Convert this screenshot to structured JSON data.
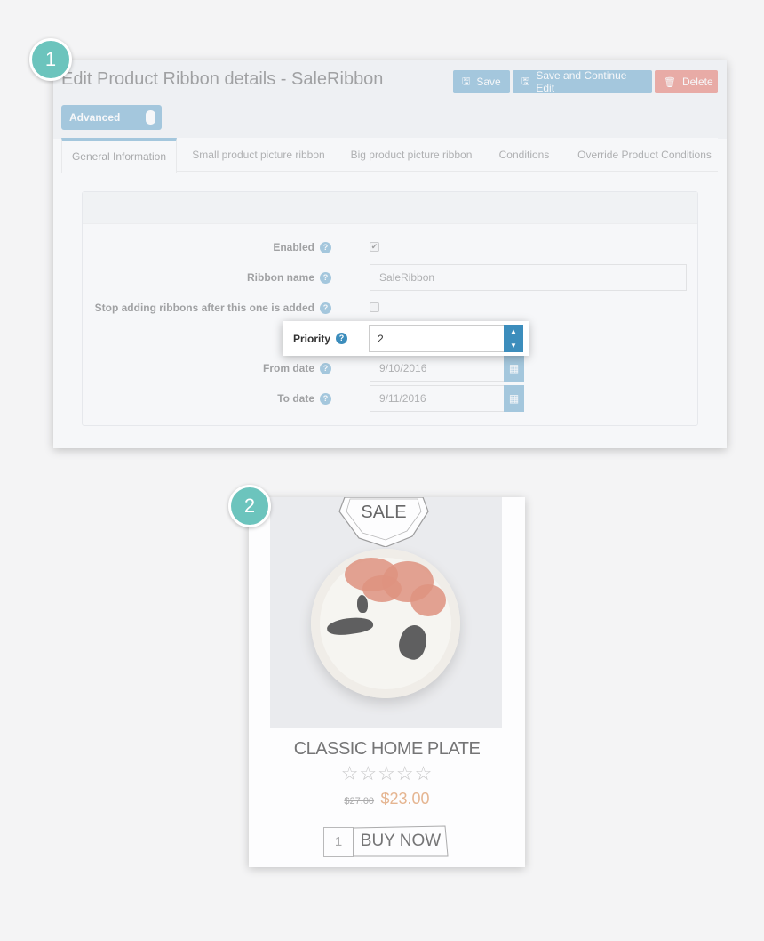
{
  "steps": {
    "first": "1",
    "second": "2"
  },
  "admin": {
    "title": "Edit Product Ribbon details - SaleRibbon",
    "buttons": {
      "save": "Save",
      "save_continue": "Save and Continue Edit",
      "delete": "Delete"
    },
    "advanced_toggle": "Advanced",
    "tabs": [
      "General Information",
      "Small product picture ribbon",
      "Big product picture ribbon",
      "Conditions",
      "Override Product Conditions"
    ],
    "fields": {
      "enabled": {
        "label": "Enabled",
        "checked": true
      },
      "ribbon_name": {
        "label": "Ribbon name",
        "value": "SaleRibbon"
      },
      "stop_adding": {
        "label": "Stop adding ribbons after this one is added",
        "checked": false
      },
      "priority": {
        "label": "Priority",
        "value": "2"
      },
      "from_date": {
        "label": "From date",
        "value": "9/10/2016"
      },
      "to_date": {
        "label": "To date",
        "value": "9/11/2016"
      }
    },
    "colors": {
      "primary": "#3c8dbc",
      "danger": "#dd4b39"
    }
  },
  "product": {
    "ribbon": "SALE",
    "name": "CLASSIC HOME PLATE",
    "rating": 0,
    "rating_max": 5,
    "old_price": "$27.00",
    "price": "$23.00",
    "quantity": "1",
    "buy_label": "BUY NOW",
    "colors": {
      "price": "#e2a677"
    }
  }
}
